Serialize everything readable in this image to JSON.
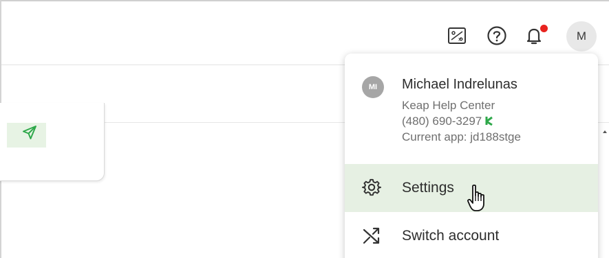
{
  "header": {
    "icons": [
      "reports-icon",
      "help-icon",
      "notifications-bell-icon"
    ],
    "avatar_initial": "M",
    "notification_dot_color": "#e8231f"
  },
  "account_menu": {
    "user_initials": "MI",
    "user_name": "Michael Indrelunas",
    "company": "Keap Help Center",
    "phone": "(480) 690-3297",
    "current_app": "Current app: jd188stge",
    "items": [
      {
        "icon": "gear-icon",
        "label": "Settings"
      },
      {
        "icon": "switch-account-icon",
        "label": "Switch account"
      }
    ],
    "hover_color": "#e6f0e3",
    "accent_color": "#2ea84a"
  }
}
